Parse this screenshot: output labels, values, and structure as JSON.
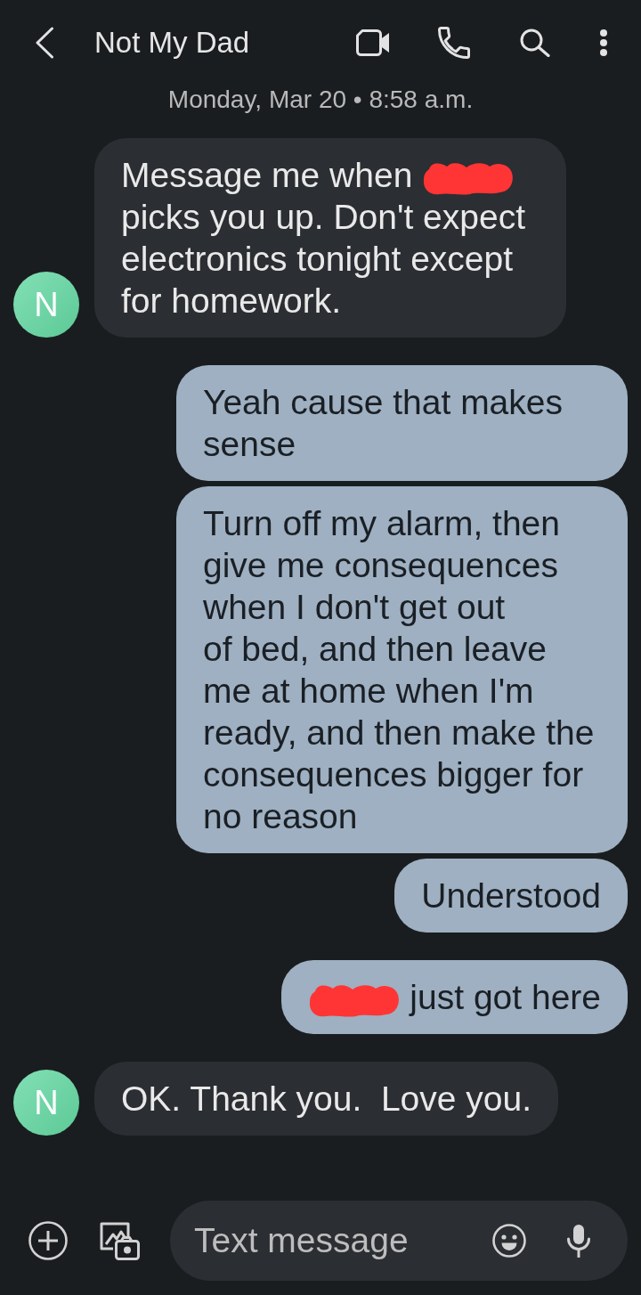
{
  "header": {
    "title": "Not My Dad"
  },
  "date_divider": "Monday, Mar 20 • 8:58 a.m.",
  "groups": [
    {
      "kind": "received",
      "avatar": "N",
      "messages": [
        {
          "parts": [
            {
              "kind": "text",
              "text": "Message me when"
            },
            {
              "kind": "redaction"
            },
            {
              "kind": "text",
              "text": "picks you up. Don't expect electronics tonight except for homework."
            }
          ]
        }
      ]
    },
    {
      "kind": "sent",
      "messages": [
        {
          "parts": [
            {
              "kind": "text",
              "text": "Yeah cause that makes sense"
            }
          ]
        },
        {
          "parts": [
            {
              "kind": "text",
              "text": "Turn off my alarm, then give me consequences when I don't get out\nof bed, and then leave me at home when I'm ready, and then make the consequences bigger for no reason"
            }
          ]
        },
        {
          "parts": [
            {
              "kind": "text",
              "text": "Understood"
            }
          ]
        }
      ]
    },
    {
      "kind": "sent",
      "messages": [
        {
          "parts": [
            {
              "kind": "redaction"
            },
            {
              "kind": "text",
              "text": "just got here"
            }
          ]
        }
      ]
    },
    {
      "kind": "received",
      "avatar": "N",
      "messages": [
        {
          "parts": [
            {
              "kind": "text",
              "text": "OK. Thank you.  Love you."
            }
          ]
        }
      ]
    }
  ],
  "composer": {
    "placeholder": "Text message"
  }
}
